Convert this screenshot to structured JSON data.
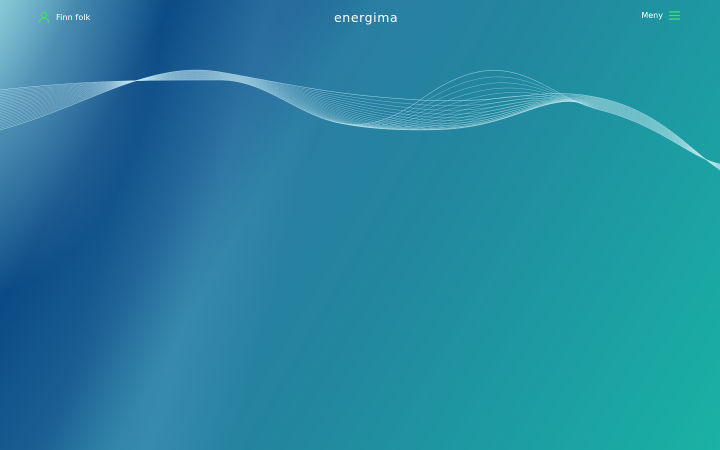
{
  "header": {
    "find_people_label": "Finn folk",
    "logo_text": "energima",
    "menu_label": "Meny"
  },
  "icons": {
    "find_people": "user-icon",
    "menu": "hamburger-menu-icon"
  },
  "colors": {
    "accent_green": "#3ee06a",
    "text": "#ffffff",
    "bg_dark_blue": "#0c4b86",
    "bg_teal": "#19b2a4"
  }
}
